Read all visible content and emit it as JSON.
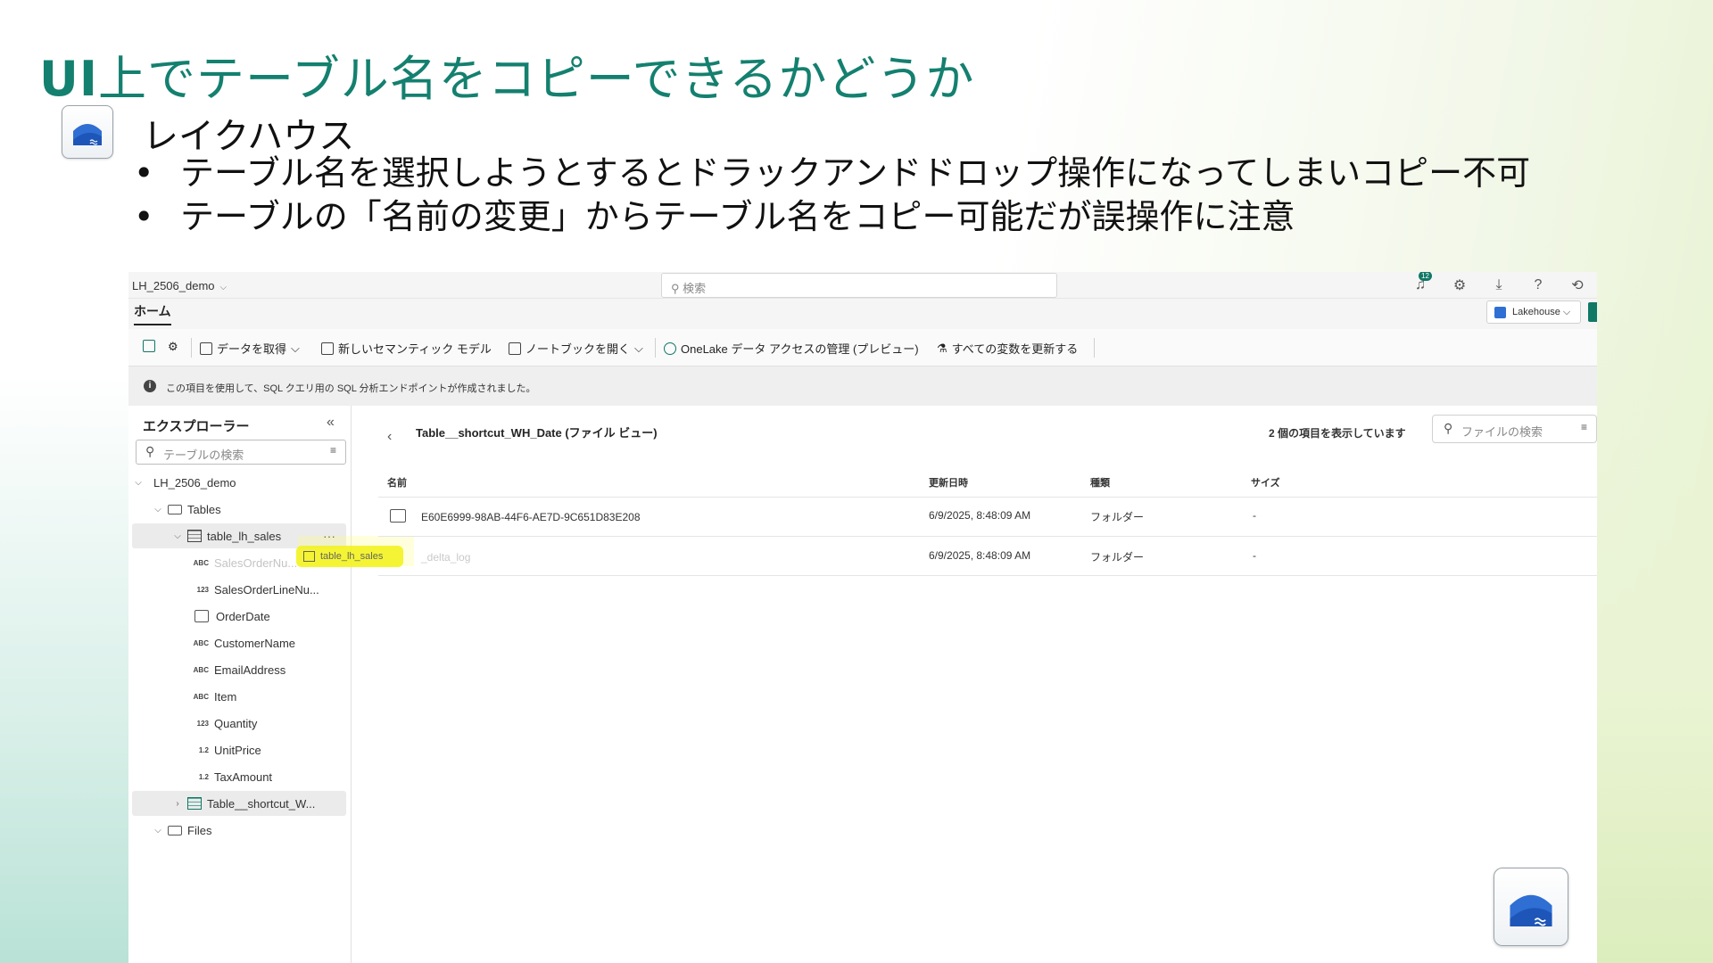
{
  "slide": {
    "title_prefix": "UI",
    "title_rest": "上でテーブル名をコピーできるかどうか",
    "subhead": "レイクハウス",
    "bullets": [
      "テーブル名を選択しようとするとドラックアンドドロップ操作になってしまいコピー不可",
      "テーブルの「名前の変更」からテーブル名をコピー可能だが誤操作に注意"
    ]
  },
  "app": {
    "workspace_name": "LH_2506_demo",
    "search_placeholder": "検索",
    "notification_count": "12",
    "tab_home": "ホーム",
    "item_type_dropdown": "Lakehouse",
    "toolbar": {
      "get_data": "データを取得",
      "new_semantic_model": "新しいセマンティック モデル",
      "open_notebook": "ノートブックを開く",
      "onelake_access": "OneLake データ アクセスの管理 (プレビュー)",
      "refresh_all": "すべての変数を更新する"
    },
    "info_text": "この項目を使用して、SQL クエリ用の SQL 分析エンドポイントが作成されました。",
    "explorer": {
      "title": "エクスプローラー",
      "search_placeholder": "テーブルの検索",
      "root": "LH_2506_demo",
      "tables_folder": "Tables",
      "table_selected": "table_lh_sales",
      "columns": [
        {
          "type": "ABC",
          "name": "SalesOrderNu..."
        },
        {
          "type": "123",
          "name": "SalesOrderLineNu..."
        },
        {
          "type": "date",
          "name": "OrderDate"
        },
        {
          "type": "ABC",
          "name": "CustomerName"
        },
        {
          "type": "ABC",
          "name": "EmailAddress"
        },
        {
          "type": "ABC",
          "name": "Item"
        },
        {
          "type": "123",
          "name": "Quantity"
        },
        {
          "type": "1.2",
          "name": "UnitPrice"
        },
        {
          "type": "1.2",
          "name": "TaxAmount"
        }
      ],
      "shortcut_table": "Table__shortcut_W...",
      "files_folder": "Files",
      "drag_label": "table_lh_sales"
    },
    "file_view": {
      "path_title": "Table__shortcut_WH_Date (ファイル ビュー)",
      "count_text": "2 個の項目を表示しています",
      "search_placeholder": "ファイルの検索",
      "headers": [
        "名前",
        "更新日時",
        "種類",
        "サイズ"
      ],
      "rows": [
        {
          "name": "E60E6999-98AB-44F6-AE7D-9C651D83E208",
          "modified": "6/9/2025, 8:48:09 AM",
          "kind": "フォルダー",
          "size": "-"
        },
        {
          "name": "_delta_log",
          "modified": "6/9/2025, 8:48:09 AM",
          "kind": "フォルダー",
          "size": "-"
        }
      ]
    }
  },
  "colors": {
    "title": "#14806f",
    "accent": "#117865",
    "highlight": "#f3f322",
    "lakehouse_blue": "#2f6fd3"
  }
}
